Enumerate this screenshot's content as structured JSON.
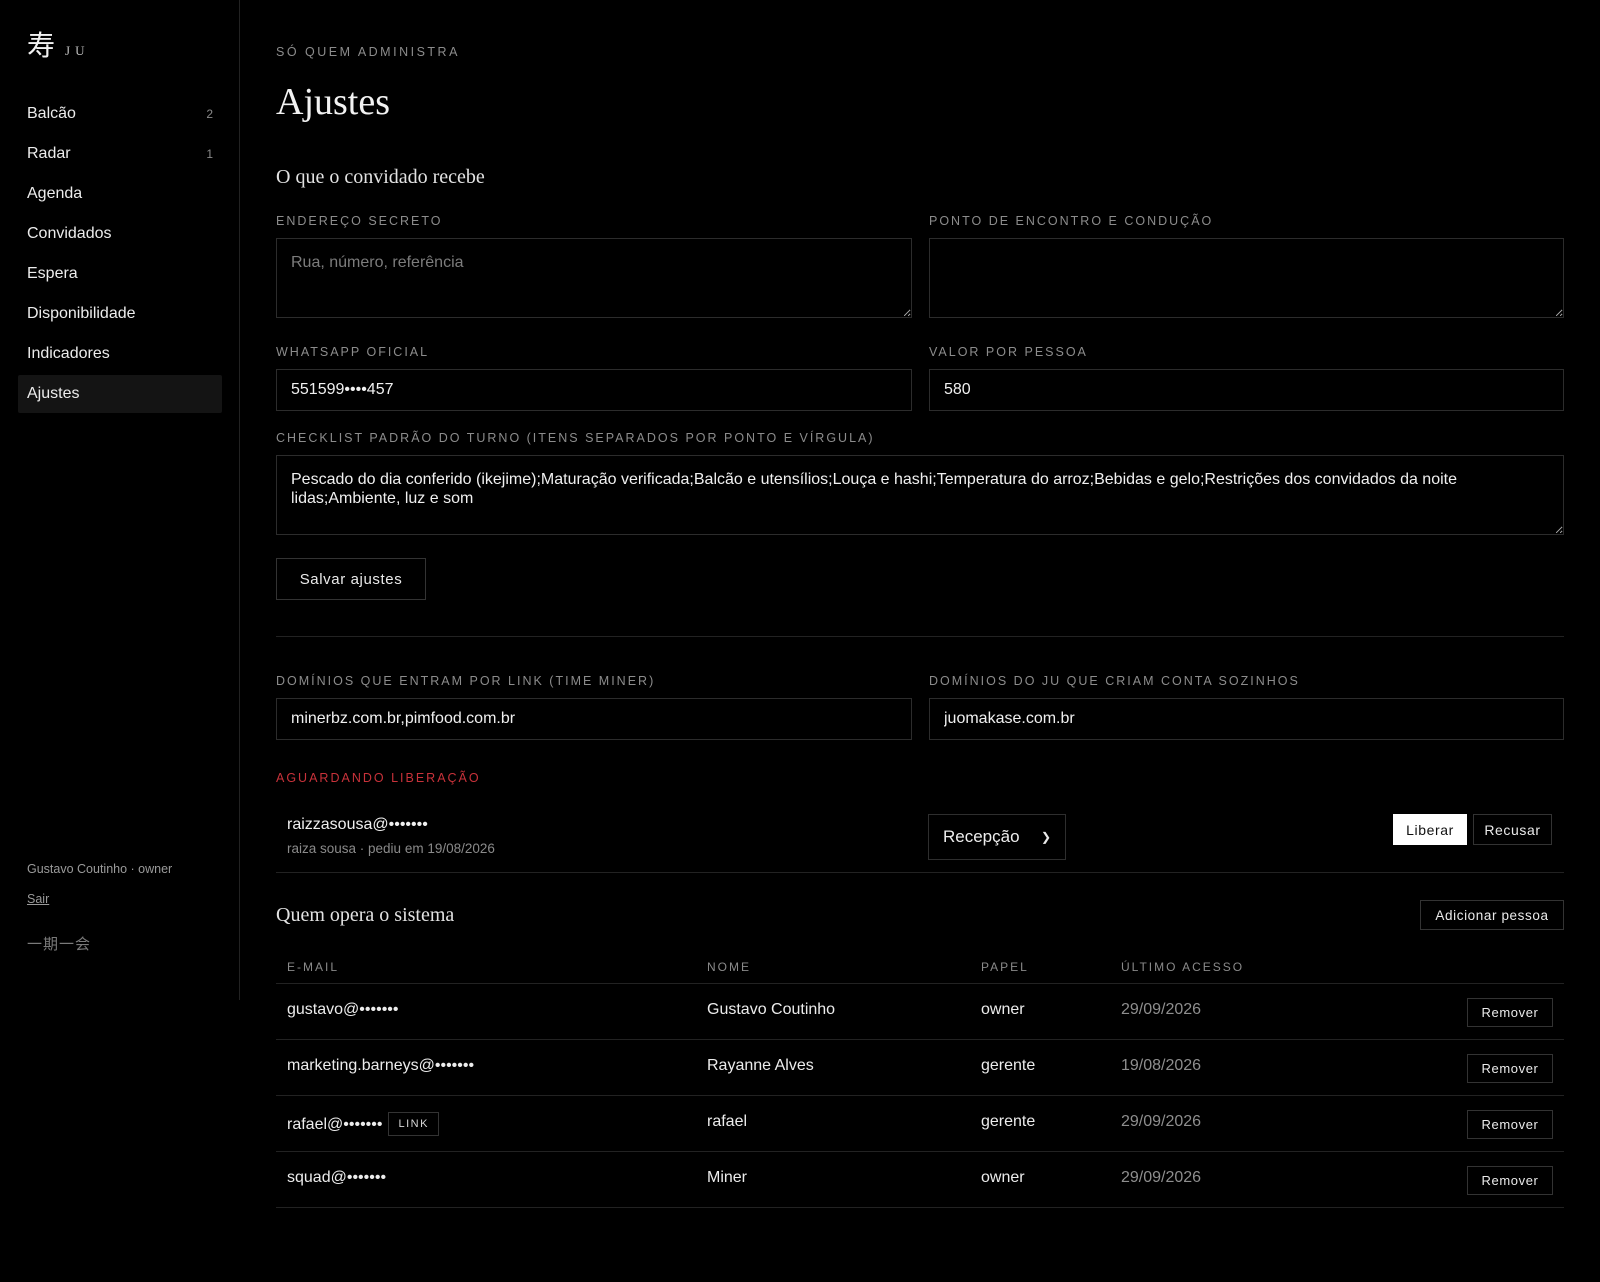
{
  "brand": {
    "kanji": "寿",
    "name": "JU"
  },
  "nav": [
    {
      "label": "Balcão",
      "count": "2"
    },
    {
      "label": "Radar",
      "count": "1"
    },
    {
      "label": "Agenda",
      "count": ""
    },
    {
      "label": "Convidados",
      "count": ""
    },
    {
      "label": "Espera",
      "count": ""
    },
    {
      "label": "Disponibilidade",
      "count": ""
    },
    {
      "label": "Indicadores",
      "count": ""
    },
    {
      "label": "Ajustes",
      "count": ""
    }
  ],
  "sidebar_footer": {
    "user": "Gustavo Coutinho · owner",
    "logout": "Sair",
    "motto": "一期一会"
  },
  "header": {
    "eyebrow": "SÓ QUEM ADMINISTRA",
    "title": "Ajustes"
  },
  "guest_section": {
    "title": "O que o convidado recebe",
    "secret_address": {
      "label": "ENDEREÇO SECRETO",
      "value": "",
      "placeholder": "Rua, número, referência"
    },
    "meeting_point": {
      "label": "PONTO DE ENCONTRO E CONDUÇÃO",
      "value": "",
      "placeholder": ""
    },
    "whatsapp": {
      "label": "WHATSAPP OFICIAL",
      "value": "551599••••457"
    },
    "price": {
      "label": "VALOR POR PESSOA",
      "value": "580"
    },
    "checklist": {
      "label": "CHECKLIST PADRÃO DO TURNO (ITENS SEPARADOS POR PONTO E VÍRGULA)",
      "value": "Pescado do dia conferido (ikejime);Maturação verificada;Balcão e utensílios;Louça e hashi;Temperatura do arroz;Bebidas e gelo;Restrições dos convidados da noite lidas;Ambiente, luz e som"
    },
    "save_label": "Salvar ajustes"
  },
  "domains": {
    "link_domains": {
      "label": "DOMÍNIOS QUE ENTRAM POR LINK (TIME MINER)",
      "value": "minerbz.com.br,pimfood.com.br"
    },
    "ju_domains": {
      "label": "DOMÍNIOS DO JU QUE CRIAM CONTA SOZINHOS",
      "value": "juomakase.com.br"
    }
  },
  "pending": {
    "label": "AGUARDANDO LIBERAÇÃO",
    "label_color": "#c8323a",
    "item": {
      "email": "raizzasousa@•••••••",
      "meta": "raiza sousa · pediu em 19/08/2026",
      "role": "Recepção",
      "approve_label": "Liberar",
      "reject_label": "Recusar"
    }
  },
  "operators": {
    "title": "Quem opera o sistema",
    "add_label": "Adicionar pessoa",
    "columns": [
      "E-MAIL",
      "NOME",
      "PAPEL",
      "ÚLTIMO ACESSO"
    ],
    "rows": [
      {
        "email": "gustavo@•••••••",
        "tag": "",
        "name": "Gustavo Coutinho",
        "role": "owner",
        "last_access": "29/09/2026",
        "action": "Remover"
      },
      {
        "email": "marketing.barneys@•••••••",
        "tag": "",
        "name": "Rayanne Alves",
        "role": "gerente",
        "last_access": "19/08/2026",
        "action": "Remover"
      },
      {
        "email": "rafael@•••••••",
        "tag": "LINK",
        "name": "rafael",
        "role": "gerente",
        "last_access": "29/09/2026",
        "action": "Remover"
      },
      {
        "email": "squad@•••••••",
        "tag": "",
        "name": "Miner",
        "role": "owner",
        "last_access": "29/09/2026",
        "action": "Remover"
      }
    ]
  }
}
